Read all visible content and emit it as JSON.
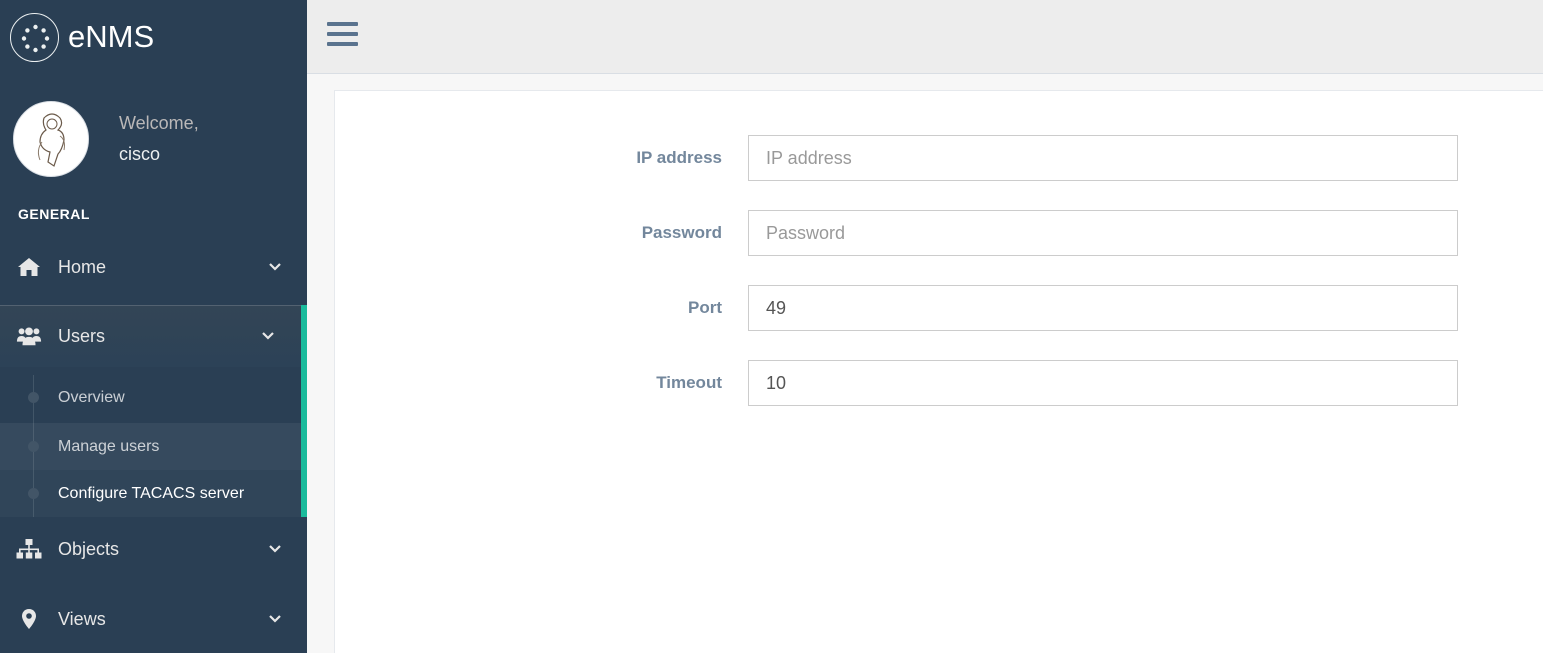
{
  "app": {
    "name": "eNMS"
  },
  "profile": {
    "welcome": "Welcome,",
    "username": "cisco"
  },
  "sidebar": {
    "section_title": "GENERAL",
    "items": [
      {
        "label": "Home",
        "icon": "home-icon"
      },
      {
        "label": "Users",
        "icon": "users-icon",
        "expanded": true,
        "children": [
          {
            "label": "Overview"
          },
          {
            "label": "Manage users"
          },
          {
            "label": "Configure TACACS server",
            "active": true
          }
        ]
      },
      {
        "label": "Objects",
        "icon": "sitemap-icon"
      },
      {
        "label": "Views",
        "icon": "map-marker-icon"
      }
    ]
  },
  "form": {
    "fields": [
      {
        "label": "IP address",
        "placeholder": "IP address",
        "value": ""
      },
      {
        "label": "Password",
        "placeholder": "Password",
        "value": ""
      },
      {
        "label": "Port",
        "placeholder": "",
        "value": "49"
      },
      {
        "label": "Timeout",
        "placeholder": "",
        "value": "10"
      }
    ]
  },
  "colors": {
    "sidebar_bg": "#2a3f54",
    "accent": "#1abb9c",
    "topbar_bg": "#ededed",
    "label_color": "#73879c"
  }
}
